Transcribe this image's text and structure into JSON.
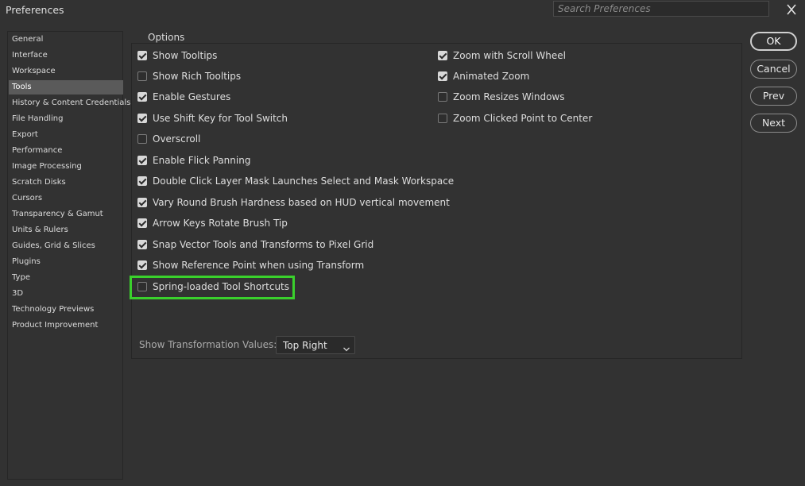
{
  "window": {
    "title": "Preferences",
    "search_placeholder": "Search Preferences",
    "close_icon": "close-icon"
  },
  "sidebar": {
    "selected": "Tools",
    "items": [
      "General",
      "Interface",
      "Workspace",
      "Tools",
      "History & Content Credentials",
      "File Handling",
      "Export",
      "Performance",
      "Image Processing",
      "Scratch Disks",
      "Cursors",
      "Transparency & Gamut",
      "Units & Rulers",
      "Guides, Grid & Slices",
      "Plugins",
      "Type",
      "3D",
      "Technology Previews",
      "Product Improvement"
    ]
  },
  "options": {
    "legend": "Options",
    "left": [
      {
        "label": "Show Tooltips",
        "checked": true
      },
      {
        "label": "Show Rich Tooltips",
        "checked": false
      },
      {
        "label": "Enable Gestures",
        "checked": true
      },
      {
        "label": "Use Shift Key for Tool Switch",
        "checked": true
      },
      {
        "label": "Overscroll",
        "checked": false
      },
      {
        "label": "Enable Flick Panning",
        "checked": true
      },
      {
        "label": "Double Click Layer Mask Launches Select and Mask Workspace",
        "checked": true
      },
      {
        "label": "Vary Round Brush Hardness based on HUD vertical movement",
        "checked": true
      },
      {
        "label": "Arrow Keys Rotate Brush Tip",
        "checked": true
      },
      {
        "label": "Snap Vector Tools and Transforms to Pixel Grid",
        "checked": true
      },
      {
        "label": "Show Reference Point when using Transform",
        "checked": true
      },
      {
        "label": "Spring-loaded Tool Shortcuts",
        "checked": false
      }
    ],
    "right": [
      {
        "label": "Zoom with Scroll Wheel",
        "checked": true
      },
      {
        "label": "Animated Zoom",
        "checked": true
      },
      {
        "label": "Zoom Resizes Windows",
        "checked": false
      },
      {
        "label": "Zoom Clicked Point to Center",
        "checked": false
      }
    ],
    "transformation_values": {
      "label": "Show Transformation Values:",
      "selected": "Top Right"
    }
  },
  "buttons": {
    "ok": "OK",
    "cancel": "Cancel",
    "prev": "Prev",
    "next": "Next"
  },
  "colors": {
    "background": "#323232",
    "highlight": "#3ad12c"
  }
}
